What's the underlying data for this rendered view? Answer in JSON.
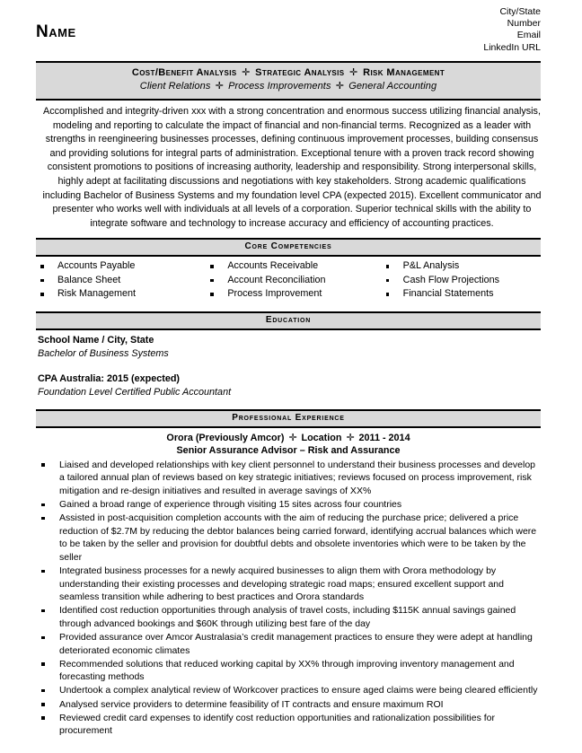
{
  "header": {
    "name": "Name",
    "contact": [
      "City/State",
      "Number",
      "Email",
      "LinkedIn URL"
    ]
  },
  "banner": {
    "separator": "✛",
    "line1_parts": [
      "Cost/Benefit Analysis",
      "Strategic Analysis",
      "Risk Management"
    ],
    "line2_parts": [
      "Client Relations",
      "Process Improvements",
      "General Accounting"
    ]
  },
  "summary": {
    "text": "Accomplished and integrity-driven xxx with a strong concentration and enormous success utilizing financial analysis, modeling and reporting to calculate the impact of financial and non-financial terms.  Recognized as a leader with strengths in reengineering businesses processes, defining continuous improvement processes, building consensus and providing solutions for integral parts of administration.  Exceptional tenure with a proven track record showing consistent promotions to positions of increasing authority, leadership and responsibility.  Strong interpersonal skills, highly adept at facilitating discussions and negotiations with key stakeholders.  Strong academic qualifications including Bachelor of Business Systems and my foundation level CPA (expected 2015). Excellent communicator and presenter who works well with individuals at all levels of a corporation. Superior technical skills with the ability to integrate software and technology to increase accuracy and efficiency of accounting practices."
  },
  "core_competencies": {
    "heading": "Core Competencies",
    "columns": [
      [
        "Accounts Payable",
        "Balance Sheet",
        "Risk Management"
      ],
      [
        "Accounts Receivable",
        "Account Reconciliation",
        "Process Improvement"
      ],
      [
        "P&L Analysis",
        "Cash Flow Projections",
        "Financial Statements"
      ]
    ]
  },
  "education": {
    "heading": "Education",
    "entries": [
      {
        "title": "School Name / City, State",
        "subtitle": "Bachelor of Business Systems"
      },
      {
        "title": "CPA Australia:  2015 (expected)",
        "subtitle": "Foundation Level Certified Public Accountant"
      }
    ]
  },
  "experience": {
    "heading": "Professional Experience",
    "company_parts": [
      "Orora (Previously Amcor)",
      "Location",
      "2011 - 2014"
    ],
    "role": "Senior Assurance Advisor – Risk and Assurance",
    "bullets": [
      "Liaised and developed relationships with key client personnel to understand their business processes and develop a tailored annual plan of reviews based on key strategic initiatives; reviews focused on process improvement, risk mitigation and re-design initiatives and resulted in average savings of XX%",
      "Gained a broad range of experience through visiting 15 sites across four countries",
      "Assisted in post-acquisition completion accounts with the aim of reducing the purchase price; delivered a price reduction of $2.7M by reducing the debtor balances being carried forward, identifying accrual balances which were to be taken by the seller and provision for doubtful debts and obsolete inventories which were to be taken by the seller",
      "Integrated business processes for a newly acquired businesses to align them with Orora methodology by understanding their existing processes and developing strategic road maps; ensured excellent support and seamless transition while adhering to best practices and Orora standards",
      "Identified cost reduction opportunities through analysis of travel costs, including $115K annual savings gained through advanced bookings and $60K through utilizing best fare of the day",
      "Provided assurance over Amcor Australasia’s credit management practices to ensure they were adept at handling deteriorated economic climates",
      "Recommended solutions that reduced working capital by XX% through improving inventory management and forecasting methods",
      "Undertook a complex analytical review of Workcover practices to ensure aged claims were being cleared efficiently",
      "Analysed service providers to determine feasibility of IT contracts and ensure maximum ROI",
      "Reviewed credit card expenses to identify cost reduction opportunities and rationalization possibilities for procurement"
    ]
  },
  "colors": {
    "bar_fill": "#d9d9d9",
    "text": "#000000",
    "page": "#ffffff"
  }
}
